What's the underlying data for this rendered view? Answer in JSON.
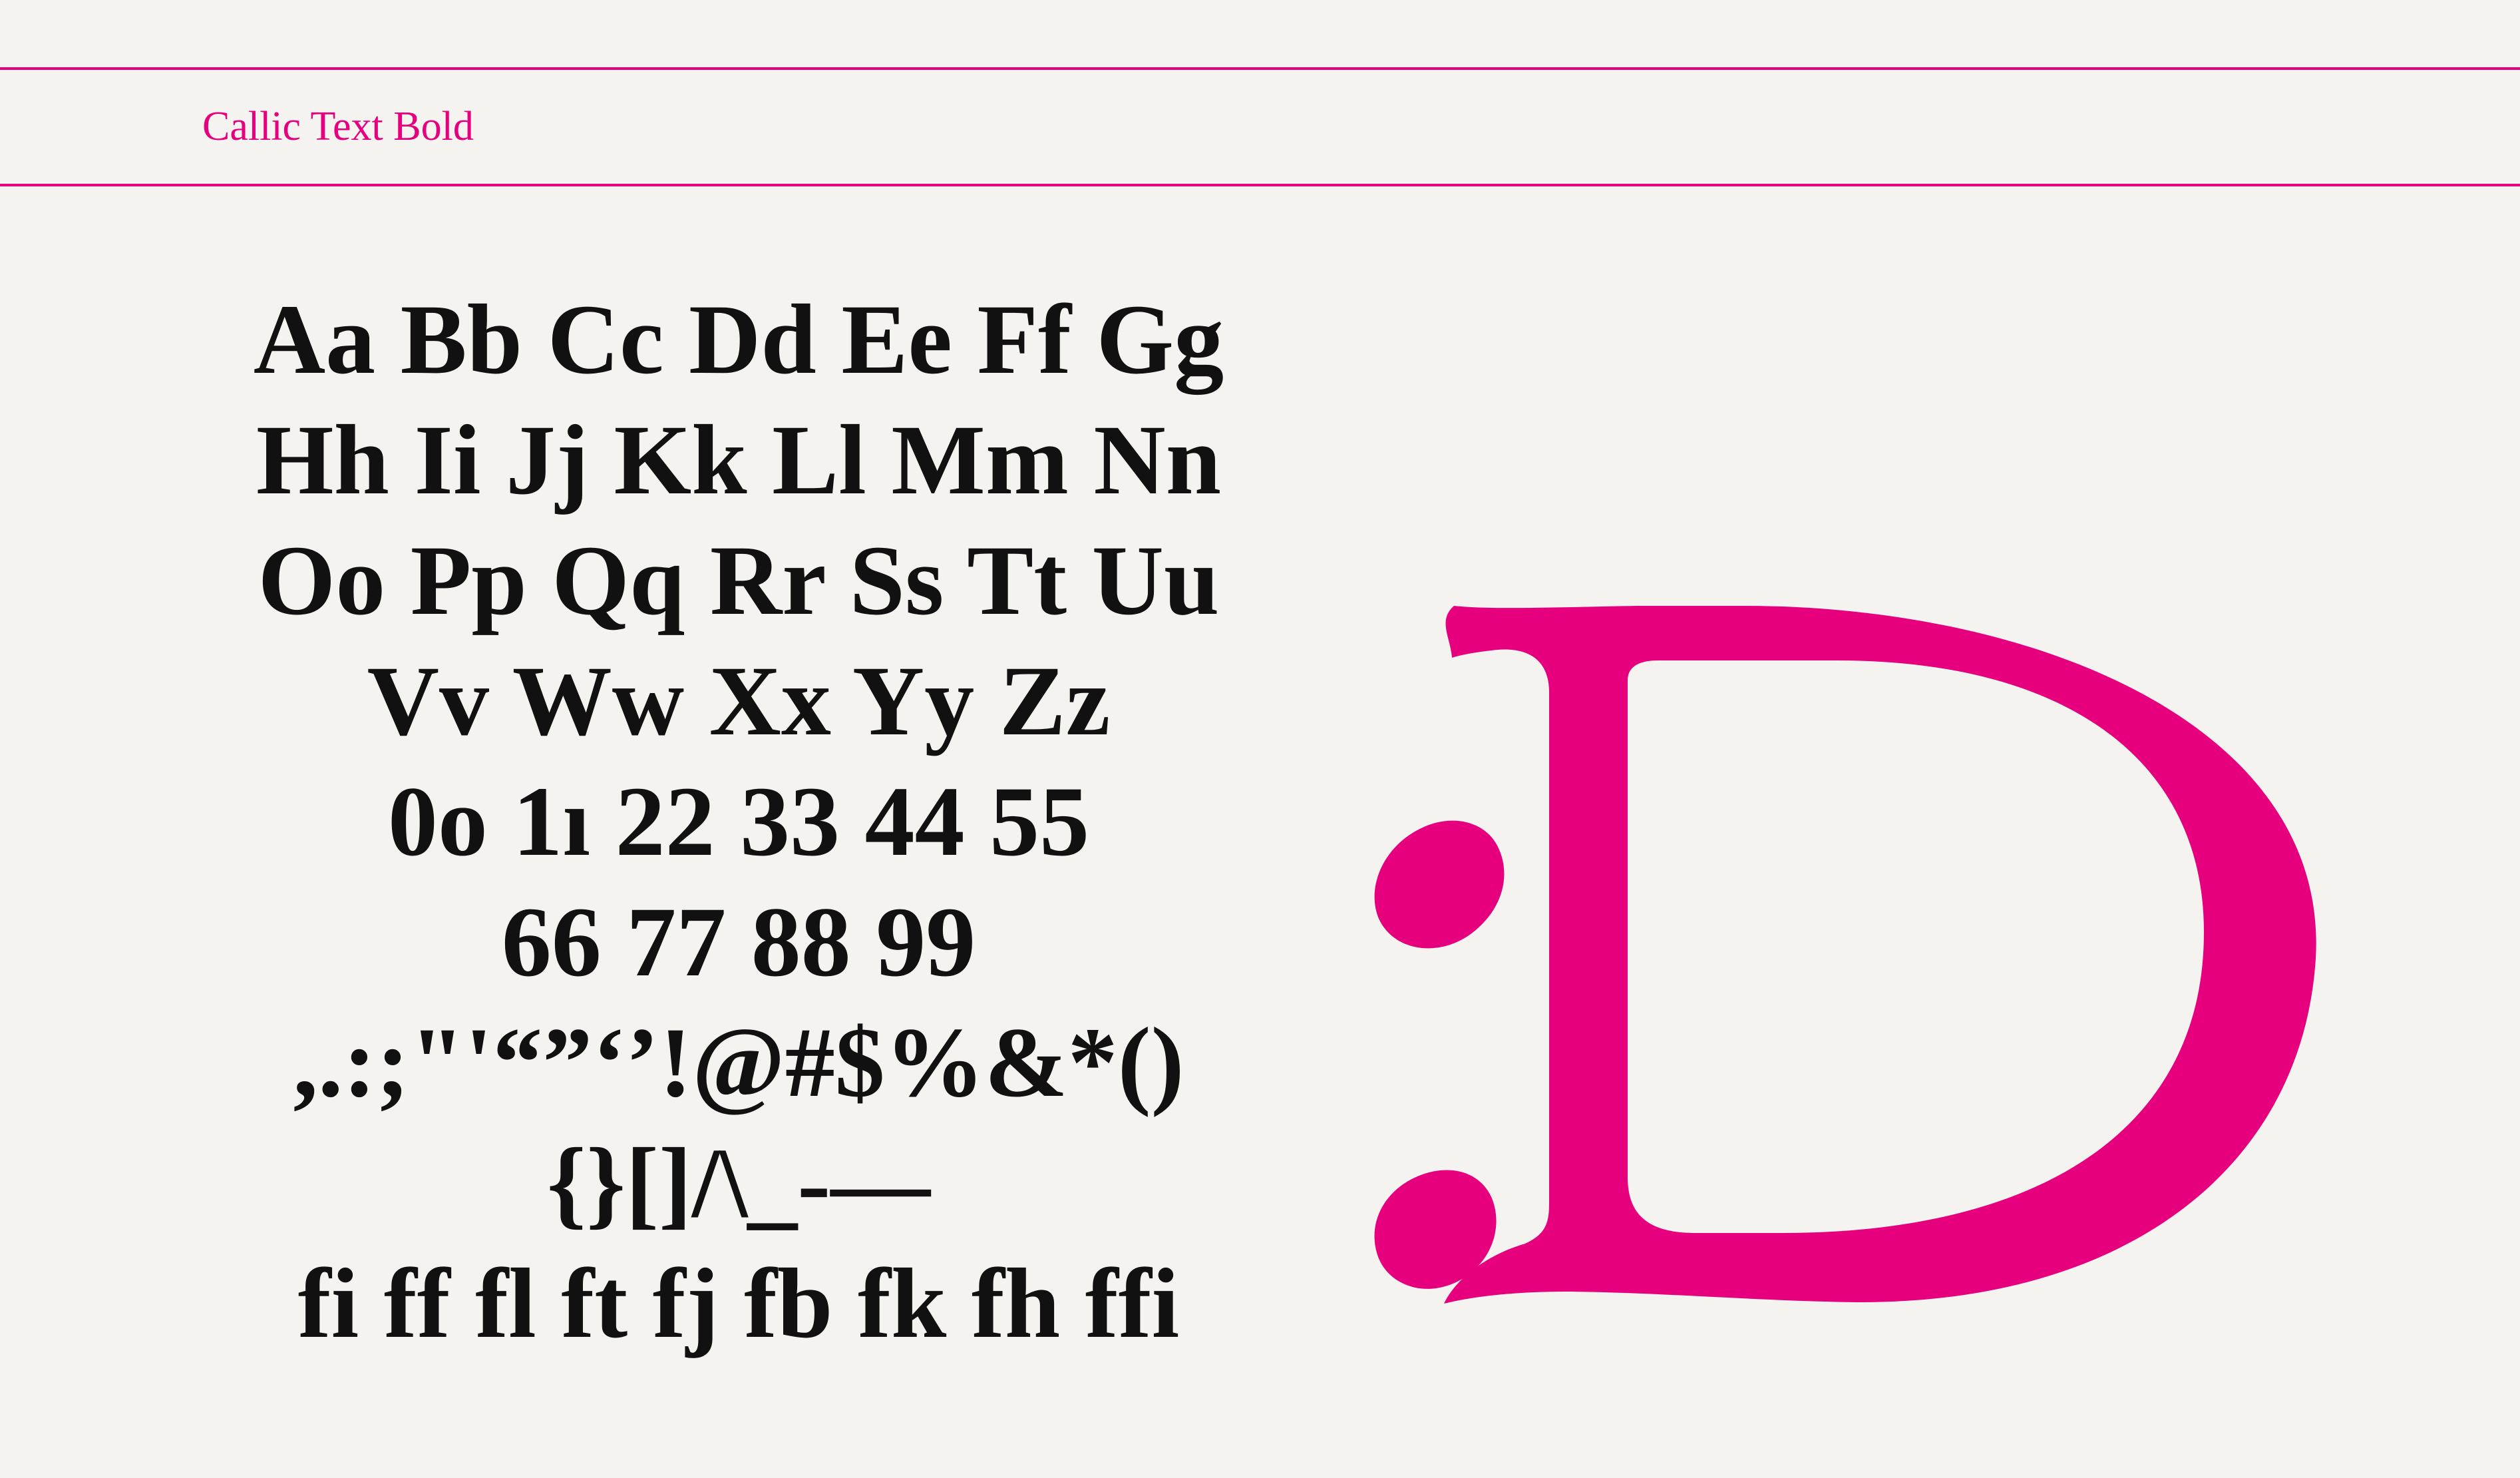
{
  "header": {
    "font_name": "Callic Text Bold"
  },
  "glyph_rows": [
    "Aa Bb Cc Dd Ee Ff Gg",
    "Hh Ii Jj Kk Ll Mm Nn",
    "Oo Pp Qq Rr Ss Tt Uu",
    "Vv Ww Xx Yy Zz",
    "0o 1ı 22 33 44 55",
    "66 77 88 99",
    ",.:;\"'“”‘’!@#$%&*()",
    "{}[]/\\_-—",
    "fi ff fl ft fj fb fk fh ffi"
  ],
  "feature": {
    "glyphs": ":D",
    "color": "#e6007e"
  },
  "colors": {
    "accent": "#e6007e",
    "background": "#f4f3ef",
    "text": "#111111"
  }
}
